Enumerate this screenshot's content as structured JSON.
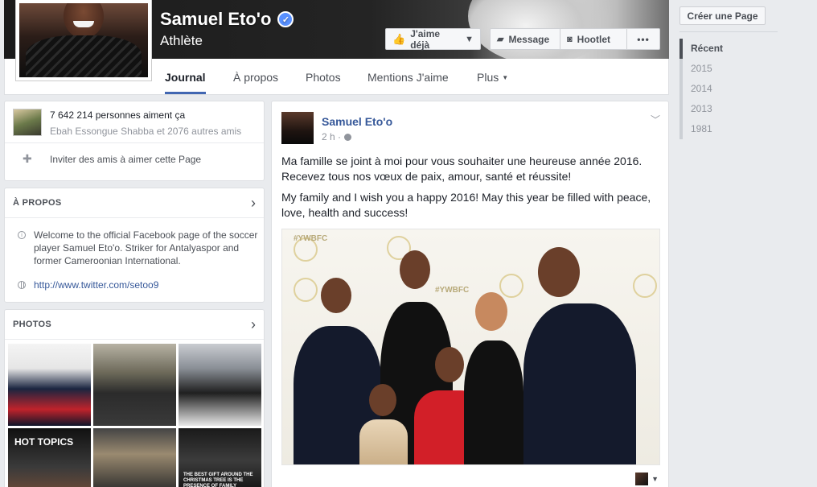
{
  "header": {
    "page_name": "Samuel Eto'o",
    "category": "Athlète",
    "like_button": "J'aime déjà",
    "message_button": "Message",
    "hootlet_button": "Hootlet",
    "more_button": "•••"
  },
  "tabs": [
    {
      "label": "Journal"
    },
    {
      "label": "À propos"
    },
    {
      "label": "Photos"
    },
    {
      "label": "Mentions J'aime"
    },
    {
      "label": "Plus"
    }
  ],
  "likes_card": {
    "count": "7 642 214 personnes aiment ça",
    "friends": "Ebah Essongue Shabba et 2076 autres amis",
    "invite": "Inviter des amis à aimer cette Page"
  },
  "about_card": {
    "title": "À PROPOS",
    "description": "Welcome to the official Facebook page of the soccer player Samuel Eto'o. Striker for Antalyaspor and former Cameroonian International.",
    "link": "http://www.twitter.com/setoo9"
  },
  "photos_card": {
    "title": "PHOTOS",
    "hot_topics": "HOT TOPICS",
    "gift_caption": "THE BEST GIFT AROUND THE CHRISTMAS TREE IS THE PRESENCE OF FAMILY"
  },
  "post": {
    "author": "Samuel Eto'o",
    "time": "2 h ·",
    "text_fr": "Ma famille se joint à moi pour vous souhaiter une heureuse année 2016. Recevez tous nos vœux de paix, amour, santé et réussite!",
    "text_en": "My family and I wish you a happy 2016! May this year be filled with peace, love, health and success!",
    "watermark": "#YWBFC"
  },
  "sidebar": {
    "create_page": "Créer une Page",
    "years": [
      "Récent",
      "2015",
      "2014",
      "2013",
      "1981"
    ]
  }
}
